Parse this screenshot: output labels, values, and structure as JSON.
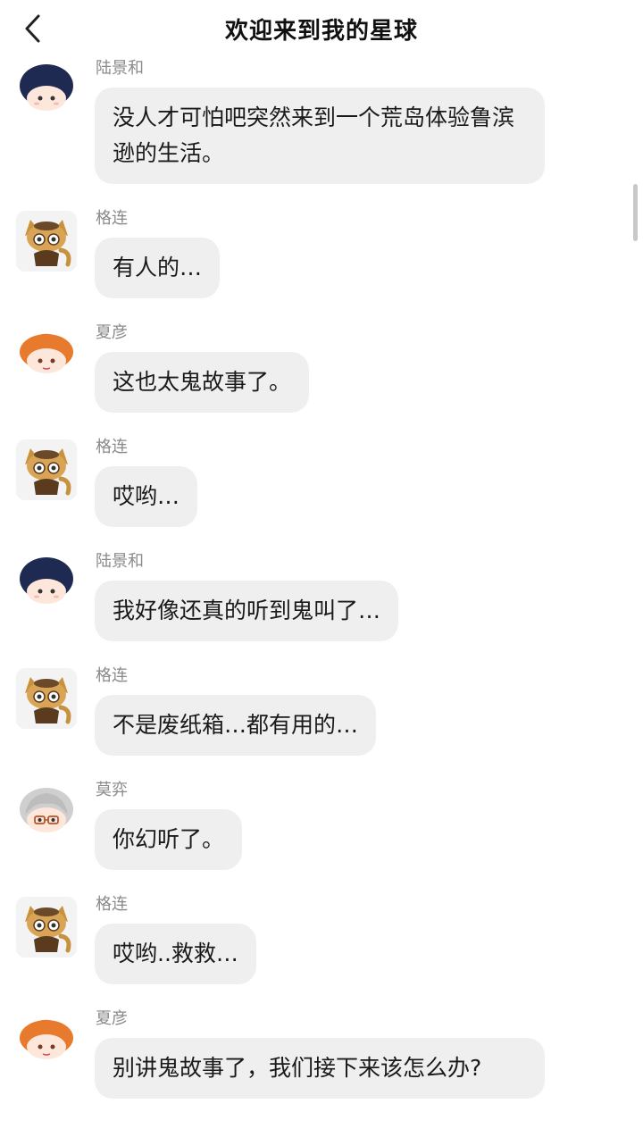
{
  "header": {
    "title": "欢迎来到我的星球",
    "back_icon": "chevron-left-icon"
  },
  "messages": [
    {
      "sender": "陆景和",
      "text": "没人才可怕吧突然来到一个荒岛体验鲁滨逊的生活。",
      "avatar": "lu-avatar"
    },
    {
      "sender": "格连",
      "text": "有人的…",
      "avatar": "ge-avatar"
    },
    {
      "sender": "夏彦",
      "text": "这也太鬼故事了。",
      "avatar": "xia-avatar"
    },
    {
      "sender": "格连",
      "text": "哎哟…",
      "avatar": "ge-avatar"
    },
    {
      "sender": "陆景和",
      "text": "我好像还真的听到鬼叫了…",
      "avatar": "lu-avatar"
    },
    {
      "sender": "格连",
      "text": "不是废纸箱…都有用的…",
      "avatar": "ge-avatar"
    },
    {
      "sender": "莫弈",
      "text": "你幻听了。",
      "avatar": "mo-avatar"
    },
    {
      "sender": "格连",
      "text": "哎哟..救救…",
      "avatar": "ge-avatar"
    },
    {
      "sender": "夏彦",
      "text": "别讲鬼故事了，我们接下来该怎么办?",
      "avatar": "xia-avatar"
    }
  ]
}
